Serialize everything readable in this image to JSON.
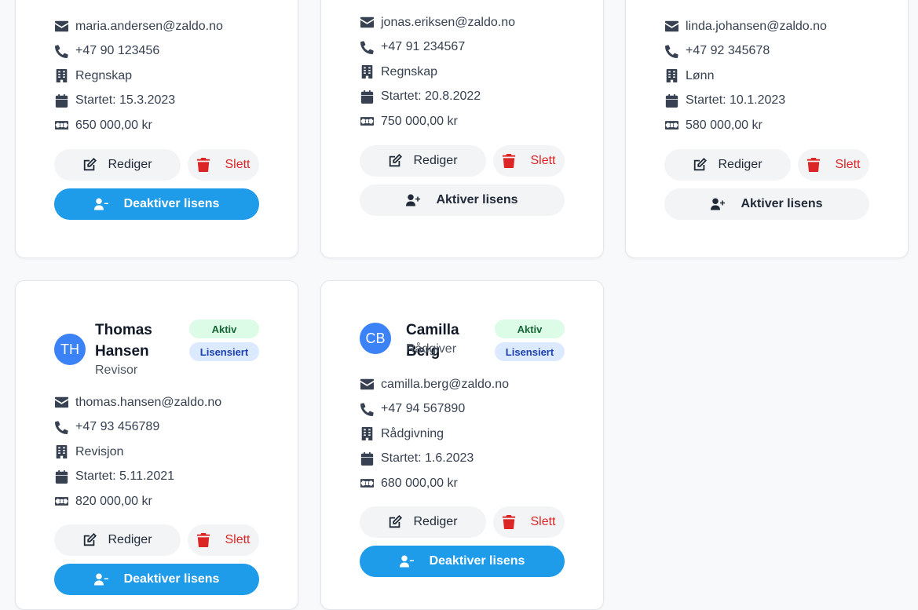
{
  "labels": {
    "edit": "Rediger",
    "delete": "Slett",
    "deactivate": "Deaktiver lisens",
    "activate": "Aktiver lisens",
    "active_badge": "Aktiv",
    "licensed_badge": "Lisensiert"
  },
  "employees": [
    {
      "email": "maria.andersen@zaldo.no",
      "phone": "+47 90 123456",
      "department": "Regnskap",
      "started": "Startet: 15.3.2023",
      "salary": "650 000,00 kr"
    },
    {
      "email": "jonas.eriksen@zaldo.no",
      "phone": "+47 91 234567",
      "department": "Regnskap",
      "started": "Startet: 20.8.2022",
      "salary": "750 000,00 kr"
    },
    {
      "email": "linda.johansen@zaldo.no",
      "phone": "+47 92 345678",
      "department": "Lønn",
      "started": "Startet: 10.1.2023",
      "salary": "580 000,00 kr"
    },
    {
      "initials": "TH",
      "name": "Thomas Hansen",
      "role": "Revisor",
      "email": "thomas.hansen@zaldo.no",
      "phone": "+47 93 456789",
      "department": "Revisjon",
      "started": "Startet: 5.11.2021",
      "salary": "820 000,00 kr"
    },
    {
      "initials": "CB",
      "name": "Camilla Berg",
      "role": "Rådgiver",
      "email": "camilla.berg@zaldo.no",
      "phone": "+47 94 567890",
      "department": "Rådgivning",
      "started": "Startet: 1.6.2023",
      "salary": "680 000,00 kr"
    }
  ],
  "icons": [
    "envelope-icon",
    "phone-icon",
    "building-icon",
    "calendar-icon",
    "money-icon",
    "edit-icon",
    "trash-icon",
    "user-minus-icon",
    "user-plus-icon"
  ],
  "colors": {
    "primary": "#1e9be9",
    "danger": "#dc2626",
    "avatar": "#3b82f6",
    "active_badge_bg": "#dcfce7",
    "licensed_badge_bg": "#dbeafe"
  }
}
